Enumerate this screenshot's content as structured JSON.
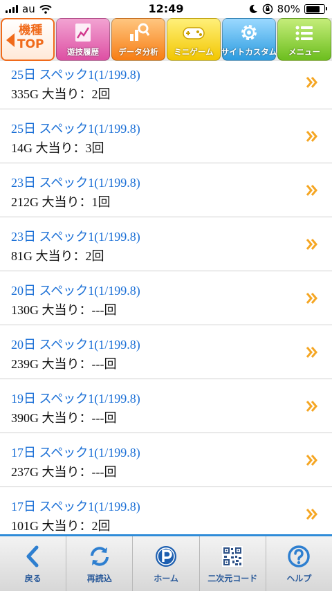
{
  "status_bar": {
    "carrier": "au",
    "time": "12:49",
    "battery_percent_text": "80%",
    "battery_level": 0.8
  },
  "top_nav": {
    "items": [
      {
        "label_line1": "機種",
        "label_line2": "TOP",
        "icon": "back-arrow-icon"
      },
      {
        "label": "遊技履歴",
        "icon": "history-chart-icon"
      },
      {
        "label": "データ分析",
        "icon": "data-analysis-icon"
      },
      {
        "label": "ミニゲーム",
        "icon": "gamepad-icon"
      },
      {
        "label": "サイトカスタム",
        "icon": "gear-icon"
      },
      {
        "label": "メニュー",
        "icon": "menu-list-icon"
      }
    ]
  },
  "records": [
    {
      "title": "25日 スペック1(1/199.8)",
      "detail": "335G 大当り：2回"
    },
    {
      "title": "25日 スペック1(1/199.8)",
      "detail": "14G 大当り：3回"
    },
    {
      "title": "23日 スペック1(1/199.8)",
      "detail": "212G 大当り：1回"
    },
    {
      "title": "23日 スペック1(1/199.8)",
      "detail": "81G 大当り：2回"
    },
    {
      "title": "20日 スペック1(1/199.8)",
      "detail": "130G 大当り：---回"
    },
    {
      "title": "20日 スペック1(1/199.8)",
      "detail": "239G 大当り：---回"
    },
    {
      "title": "19日 スペック1(1/199.8)",
      "detail": "390G 大当り：---回"
    },
    {
      "title": "17日 スペック1(1/199.8)",
      "detail": "237G 大当り：---回"
    },
    {
      "title": "17日 スペック1(1/199.8)",
      "detail": "101G 大当り：2回"
    }
  ],
  "bottom_bar": {
    "items": [
      {
        "label": "戻る",
        "icon": "back-chevron-icon"
      },
      {
        "label": "再読込",
        "icon": "reload-icon"
      },
      {
        "label": "ホーム",
        "icon": "p-logo-home-icon"
      },
      {
        "label": "二次元コード",
        "icon": "qr-code-icon"
      },
      {
        "label": "ヘルプ",
        "icon": "help-icon"
      }
    ]
  },
  "colors": {
    "link_blue": "#1a6fd6",
    "chevron_orange": "#f5a623",
    "accent_blue": "#2e8bd8"
  }
}
